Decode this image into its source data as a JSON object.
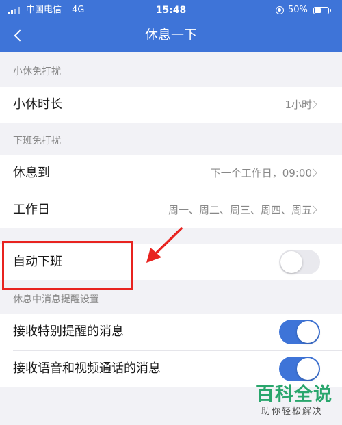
{
  "status_bar": {
    "carrier": "中国电信",
    "network": "4G",
    "time": "15:48",
    "battery": "50%",
    "battery_level": 0.5
  },
  "header": {
    "title": "休息一下",
    "back_icon": "chevron-left-icon"
  },
  "sections": {
    "break": {
      "header": "小休免打扰",
      "duration_label": "小休时长",
      "duration_value": "1小时"
    },
    "offwork": {
      "header": "下班免打扰",
      "rest_until_label": "休息到",
      "rest_until_value": "下一个工作日，09:00",
      "workdays_label": "工作日",
      "workdays_value": "周一、周二、周三、周四、周五",
      "auto_off_label": "自动下班",
      "auto_off_enabled": false
    },
    "notifications": {
      "header": "休息中消息提醒设置",
      "special_label": "接收特别提醒的消息",
      "special_enabled": true,
      "call_label": "接收语音和视频通话的消息",
      "call_enabled": true
    }
  },
  "watermark": {
    "title": "百科全说",
    "subtitle": "助你轻松解决"
  },
  "colors": {
    "accent": "#3e74d8",
    "annotation": "#e8231f",
    "watermark": "#29a66c"
  }
}
